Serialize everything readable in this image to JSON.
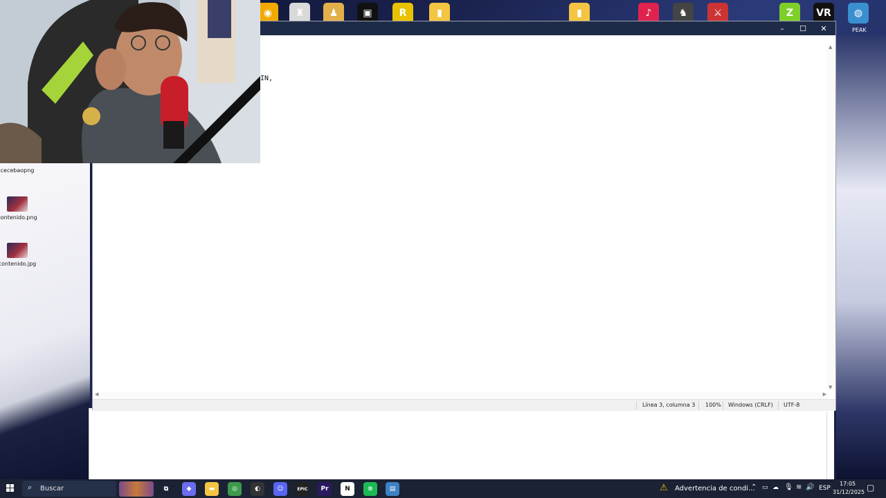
{
  "desktop": {
    "top_icons": [
      {
        "name": "app-icon-1",
        "glyph": "◉",
        "color": "#f2a900"
      },
      {
        "name": "app-icon-2",
        "glyph": "♜",
        "color": "#d9d9d9"
      },
      {
        "name": "app-icon-3",
        "glyph": "♟",
        "color": "#e2b04a"
      },
      {
        "name": "roblox-icon",
        "glyph": "▣",
        "color": "#111111"
      },
      {
        "name": "app-icon-5",
        "glyph": "R",
        "color": "#e8c200"
      },
      {
        "name": "folder-icon-1",
        "glyph": "▮",
        "color": "#f4c542"
      },
      {
        "name": "folder-icon-2",
        "glyph": "▮",
        "color": "#f4c542"
      },
      {
        "name": "tiktok-icon",
        "glyph": "♪",
        "color": "#e0224e"
      },
      {
        "name": "hollow-knight-icon",
        "glyph": "♞",
        "color": "#444444"
      },
      {
        "name": "app-icon-10",
        "glyph": "⚔",
        "color": "#cc3333"
      },
      {
        "name": "app-icon-11",
        "glyph": "Z",
        "color": "#7fcf2a"
      },
      {
        "name": "vr-icon",
        "glyph": "VR",
        "color": "#111111"
      },
      {
        "name": "peak-icon",
        "glyph": "◍",
        "color": "#3a8fd0"
      }
    ],
    "top_label_peak": "PEAK",
    "left_icons": [
      {
        "label": "cecebaopng"
      },
      {
        "label": "contenido.png"
      },
      {
        "label": "contenido.jpg"
      }
    ]
  },
  "notepad": {
    "title_buttons": {
      "minimize": "–",
      "maximize": "☐",
      "close": "✕"
    },
    "content": "IN,",
    "status": {
      "position": "Línea 3, columna 3",
      "zoom": "100%",
      "line_ending": "Windows (CRLF)",
      "encoding": "UTF-8"
    }
  },
  "taskbar": {
    "search_placeholder": "Buscar",
    "apps": [
      {
        "name": "task-view-icon",
        "glyph": "⧉",
        "color": "#1b2233"
      },
      {
        "name": "copilot-icon",
        "glyph": "◆",
        "color": "#6b6cf0"
      },
      {
        "name": "file-explorer-icon",
        "glyph": "▬",
        "color": "#f4c542"
      },
      {
        "name": "chrome-icon",
        "glyph": "◎",
        "color": "#3c9a4b"
      },
      {
        "name": "obs-icon",
        "glyph": "◐",
        "color": "#333333"
      },
      {
        "name": "discord-icon",
        "glyph": "☺",
        "color": "#5865f2"
      },
      {
        "name": "epic-games-icon",
        "glyph": "EPIC",
        "color": "#222222"
      },
      {
        "name": "premiere-pro-icon",
        "glyph": "Pr",
        "color": "#2a1a5e"
      },
      {
        "name": "notion-icon",
        "glyph": "N",
        "color": "#ffffff"
      },
      {
        "name": "spotify-icon",
        "glyph": "≋",
        "color": "#1db954"
      },
      {
        "name": "notepad-icon",
        "glyph": "▤",
        "color": "#3d82c4"
      }
    ],
    "warning_text": "Advertencia de condi...",
    "language": "ESP",
    "time": "17:05",
    "date": "31/12/2025"
  }
}
